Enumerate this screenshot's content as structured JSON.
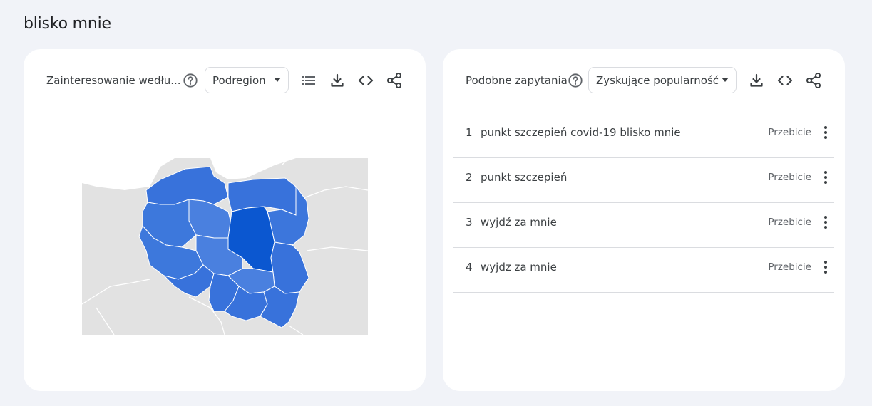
{
  "page": {
    "title": "blisko mnie"
  },
  "left_card": {
    "title": "Zainteresowanie wedłu...",
    "dropdown_value": "Podregion",
    "icons": [
      "help-icon",
      "list-icon",
      "download-icon",
      "embed-code-icon",
      "share-icon"
    ]
  },
  "right_card": {
    "title": "Podobne zapytania",
    "dropdown_value": "Zyskujące popularność",
    "icons": [
      "help-icon",
      "download-icon",
      "embed-code-icon",
      "share-icon"
    ],
    "queries": [
      {
        "rank": "1",
        "text": "punkt szczepień covid-19 blisko mnie",
        "value": "Przebicie"
      },
      {
        "rank": "2",
        "text": "punkt szczepień",
        "value": "Przebicie"
      },
      {
        "rank": "3",
        "text": "wyjdź za mnie",
        "value": "Przebicie"
      },
      {
        "rank": "4",
        "text": "wyjdz za mnie",
        "value": "Przebicie"
      }
    ]
  },
  "colors": {
    "region_highest": "#0b57d0",
    "region_high": "#3872db",
    "region_mid": "#4a80df",
    "background_land": "#e2e2e2"
  }
}
